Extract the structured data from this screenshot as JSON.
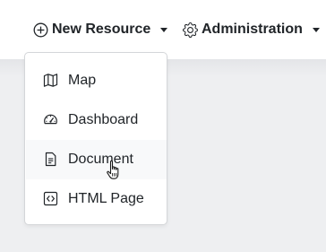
{
  "nav": {
    "new_resource": {
      "label": "New Resource",
      "icon": "plus-circle-icon"
    },
    "administration": {
      "label": "Administration",
      "icon": "gear-icon"
    }
  },
  "dropdown": {
    "items": [
      {
        "label": "Map",
        "icon": "map-icon"
      },
      {
        "label": "Dashboard",
        "icon": "speedometer-icon"
      },
      {
        "label": "Document",
        "icon": "document-icon",
        "hovered": true
      },
      {
        "label": "HTML Page",
        "icon": "code-file-icon"
      }
    ]
  },
  "colors": {
    "text": "#212529",
    "hover_bg": "#f8f9fa",
    "page_bg": "#eeeff1",
    "border": "#d4d6d9"
  }
}
